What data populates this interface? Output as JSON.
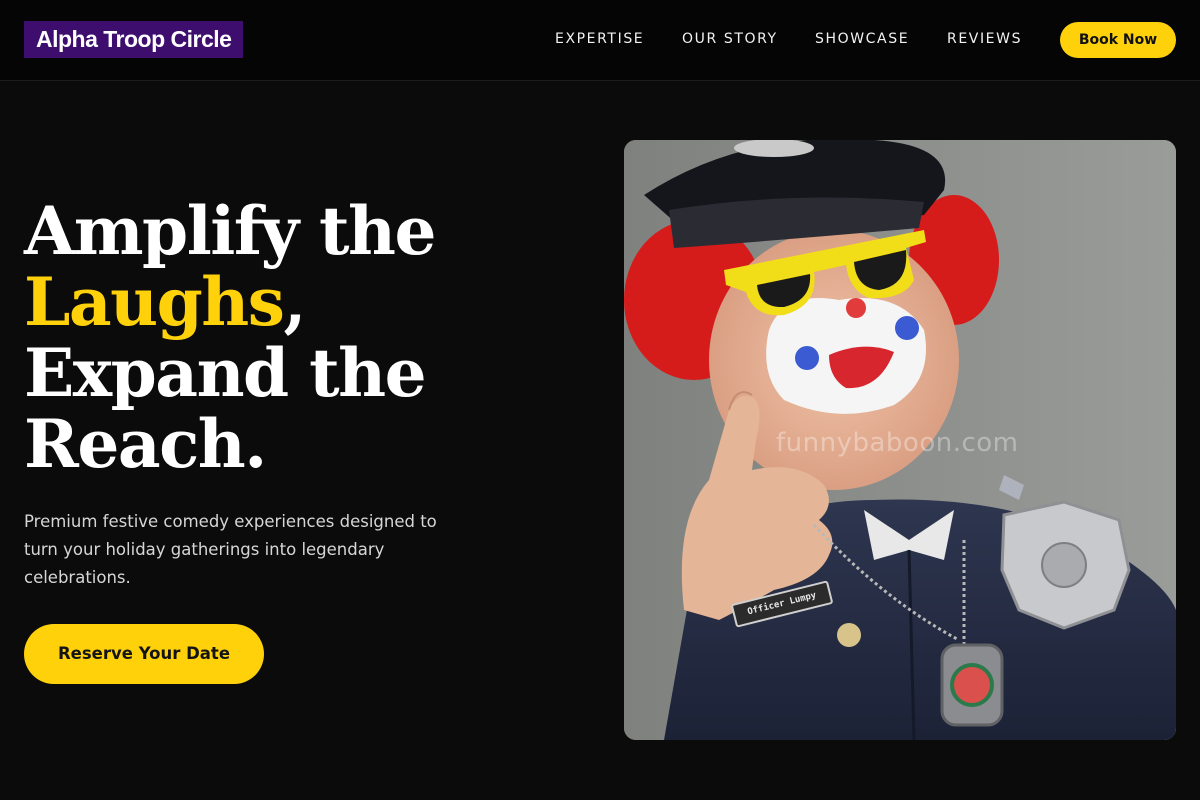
{
  "brand": {
    "logo_text": "Alpha Troop Circle"
  },
  "nav": {
    "items": [
      {
        "label": "EXPERTISE"
      },
      {
        "label": "OUR STORY"
      },
      {
        "label": "SHOWCASE"
      },
      {
        "label": "REVIEWS"
      }
    ],
    "cta_label": "Book Now"
  },
  "hero": {
    "title_line1": "Amplify the",
    "title_accent": "Laughs",
    "title_comma": ",",
    "title_line3": "Expand the",
    "title_line4": "Reach.",
    "subtitle": "Premium festive comedy experiences designed to turn your holiday gatherings into legendary celebrations.",
    "cta_label": "Reserve Your Date"
  },
  "photo": {
    "watermark": "funnybaboon.com",
    "name_tag": "Officer Lumpy"
  },
  "colors": {
    "accent": "#ffd10a",
    "logo_bg": "#3d0e6e",
    "background": "#0b0b0c"
  }
}
